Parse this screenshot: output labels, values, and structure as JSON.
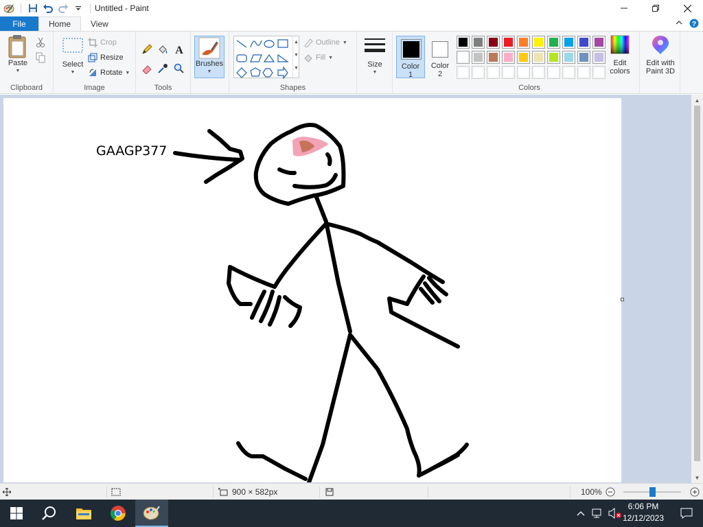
{
  "window": {
    "title": "Untitled - Paint"
  },
  "ribbon": {
    "tabs": {
      "file": "File",
      "home": "Home",
      "view": "View"
    },
    "clipboard": {
      "paste": "Paste",
      "label": "Clipboard"
    },
    "image": {
      "select": "Select",
      "crop": "Crop",
      "resize": "Resize",
      "rotate": "Rotate",
      "label": "Image"
    },
    "tools": {
      "label": "Tools"
    },
    "brushes": {
      "label": "Brushes"
    },
    "shapes": {
      "outline": "Outline",
      "fill": "Fill",
      "label": "Shapes"
    },
    "size": {
      "label": "Size"
    },
    "color1": {
      "label": "Color",
      "num": "1",
      "color": "#000000"
    },
    "color2": {
      "label": "Color",
      "num": "2",
      "color": "#ffffff"
    },
    "colors": {
      "label": "Colors",
      "palette_row1": [
        "#000000",
        "#7f7f7f",
        "#880015",
        "#ed1c24",
        "#ff7f27",
        "#fff200",
        "#22b14c",
        "#00a2e8",
        "#3f48cc",
        "#a349a4"
      ],
      "palette_row2": [
        "#ffffff",
        "#c3c3c3",
        "#b97a57",
        "#ffaec9",
        "#ffc90e",
        "#efe4b0",
        "#b5e61d",
        "#99d9ea",
        "#7092be",
        "#c8bfe7"
      ],
      "custom_row": [
        "#ffffff",
        "#ffffff",
        "#ffffff",
        "#ffffff",
        "#ffffff",
        "#ffffff",
        "#ffffff",
        "#ffffff",
        "#ffffff",
        "#ffffff"
      ]
    },
    "edit_colors": {
      "line1": "Edit",
      "line2": "colors"
    },
    "paint3d": {
      "line1": "Edit with",
      "line2": "Paint 3D"
    }
  },
  "canvas": {
    "text": "GAAGP377"
  },
  "statusbar": {
    "dimensions": "900 × 582px",
    "zoom": "100%"
  },
  "taskbar": {
    "time": "6:06 PM",
    "date": "12/12/2023"
  }
}
